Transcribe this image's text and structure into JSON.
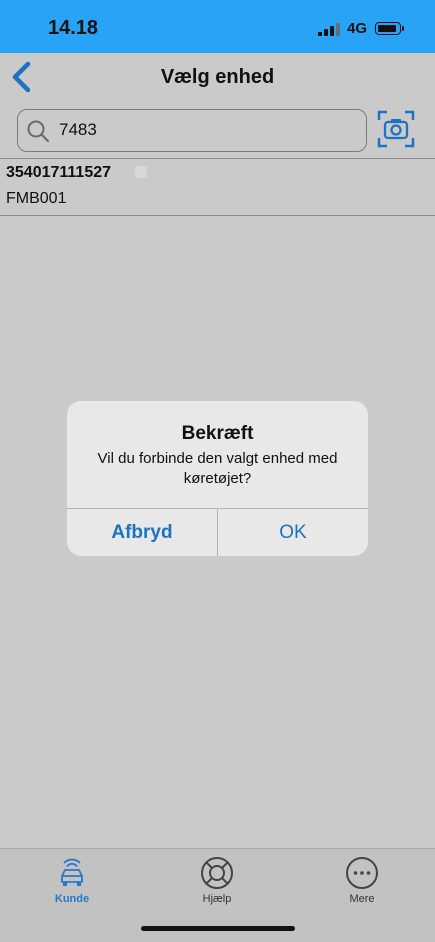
{
  "status_bar": {
    "time": "14.18",
    "network": "4G"
  },
  "nav": {
    "title": "Vælg enhed"
  },
  "search": {
    "value": "7483"
  },
  "device_item": {
    "id_text": "354017111527",
    "name": "FMB001"
  },
  "dialog": {
    "title": "Bekræft",
    "message": "Vil du forbinde den valgt enhed med køretøjet?",
    "cancel_label": "Afbryd",
    "ok_label": "OK"
  },
  "tabs": [
    {
      "label": "Kunde",
      "icon": "car-wifi-icon",
      "active": true
    },
    {
      "label": "Hjælp",
      "icon": "lifebuoy-icon",
      "active": false
    },
    {
      "label": "Mere",
      "icon": "more-dots-icon",
      "active": false
    }
  ],
  "colors": {
    "status_bar": "#29a3f5",
    "accent": "#1d72c2",
    "background": "#cacaca"
  }
}
